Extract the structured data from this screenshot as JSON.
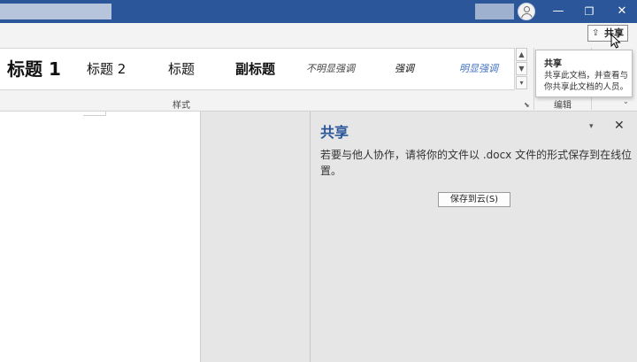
{
  "titlebar": {
    "window_controls": {
      "minimize": "—",
      "restore": "❐",
      "close": "✕"
    }
  },
  "commands": {
    "share_icon": "share-icon",
    "share_label": "共享"
  },
  "ribbon": {
    "styles": [
      "标题 1",
      "标题 2",
      "标题",
      "副标题",
      "不明显强调",
      "强调",
      "明显强调"
    ],
    "styles_group_label": "样式",
    "edit_group_label": "编辑",
    "gallery_controls": {
      "up": "▲",
      "down": "▼",
      "more": "▾"
    },
    "dialog_launcher": "⬊",
    "collapse": "⌄"
  },
  "tooltip": {
    "title": "共享",
    "body": "共享此文档，并查看与你共享此文档的人员。"
  },
  "share_pane": {
    "title": "共享",
    "menu_glyph": "▾",
    "close_glyph": "✕",
    "description": "若要与他人协作，请将你的文件以 .docx 文件的形式保存到在线位置。",
    "save_button": "保存到云(S)"
  },
  "colors": {
    "title_bar": "#2b579a",
    "accent_text": "#2b579a",
    "subtle_emphasis": "#444444",
    "intense_emphasis": "#4472c4"
  }
}
